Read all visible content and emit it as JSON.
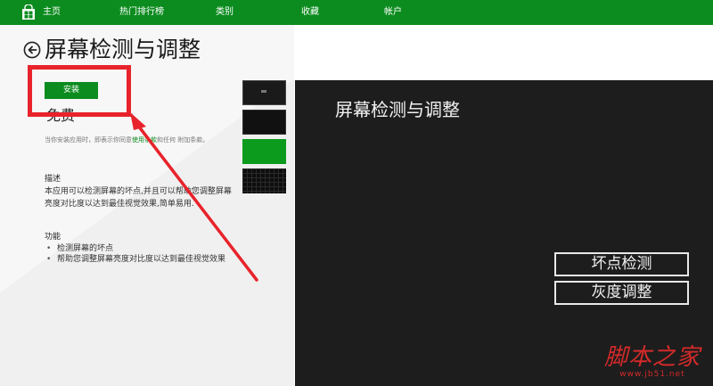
{
  "nav": {
    "items": [
      {
        "label": "主页"
      },
      {
        "label": "热门排行榜"
      },
      {
        "label": "类别"
      },
      {
        "label": "收藏"
      },
      {
        "label": "帐户"
      }
    ]
  },
  "app": {
    "title": "屏幕检测与调整",
    "install_label": "安装",
    "price": "免费",
    "rating_text": "· · · · ·",
    "terms_before": "当你安装应用时，即表示你同意",
    "terms_link": "使用条款",
    "terms_after": "和任何 附加条款。",
    "desc_heading": "描述",
    "description": "本应用可以检测屏幕的坏点,并且可以帮助您调整屏幕亮度对比度以达到最佳视觉效果,简单易用.",
    "features_heading": "功能",
    "features": [
      "检测屏幕的坏点",
      "帮助您调整屏幕亮度对比度以达到最佳视觉效果"
    ]
  },
  "preview": {
    "title": "屏幕检测与调整",
    "button_dead_pixel": "坏点检测",
    "button_gray_adjust": "灰度调整"
  },
  "watermark": {
    "main": "脚本之家",
    "sub": "www.jb51.net"
  },
  "colors": {
    "brand_green": "#0c8c1f",
    "annotation_red": "#e8232b"
  }
}
